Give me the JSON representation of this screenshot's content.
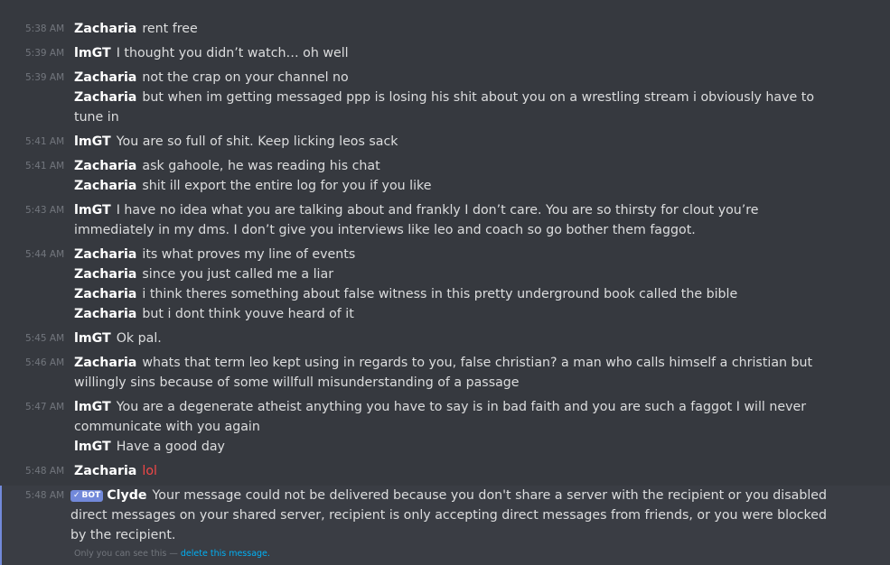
{
  "messages": [
    {
      "time": "5:38 AM",
      "author": "Zacharia",
      "text": "rent free",
      "first": true
    },
    {
      "time": "5:39 AM",
      "author": "lmGT",
      "text": "I thought you didn’t watch… oh well",
      "first": true
    },
    {
      "time": "5:39 AM",
      "author": "Zacharia",
      "text": "not the crap on your channel no",
      "first": true
    },
    {
      "time": "",
      "author": "Zacharia",
      "text": "but when im getting messaged ppp is losing his shit about you on a wrestling stream i obviously have to tune in",
      "first": false
    },
    {
      "time": "5:41 AM",
      "author": "lmGT",
      "text": "You are so full of shit. Keep licking leos sack",
      "first": true
    },
    {
      "time": "5:41 AM",
      "author": "Zacharia",
      "text": "ask gahoole, he was reading his chat",
      "first": true
    },
    {
      "time": "",
      "author": "Zacharia",
      "text": "shit ill export the entire log for you if you like",
      "first": false
    },
    {
      "time": "5:43 AM",
      "author": "lmGT",
      "text": "I have no idea what you are talking about and frankly I don’t care. You are so thirsty for clout you’re immediately in my dms. I don’t give you interviews like leo and coach so go bother them faggot.",
      "first": true
    },
    {
      "time": "5:44 AM",
      "author": "Zacharia",
      "text": "its what proves my line of events",
      "first": true
    },
    {
      "time": "",
      "author": "Zacharia",
      "text": "since you just called me a liar",
      "first": false
    },
    {
      "time": "",
      "author": "Zacharia",
      "text": "i think theres something about false witness in this pretty underground book called the bible",
      "first": false
    },
    {
      "time": "",
      "author": "Zacharia",
      "text": "but i dont think youve heard of it",
      "first": false
    },
    {
      "time": "5:45 AM",
      "author": "lmGT",
      "text": "Ok pal.",
      "first": true
    },
    {
      "time": "5:46 AM",
      "author": "Zacharia",
      "text": "whats that term leo kept using in regards to you, false christian? a man who calls himself a christian but willingly sins because of some willfull misunderstanding of a passage",
      "first": true
    },
    {
      "time": "5:47 AM",
      "author": "lmGT",
      "text": "You are a degenerate atheist anything you have to say is in bad faith and you are such a faggot I will never communicate with you again",
      "first": true
    },
    {
      "time": "",
      "author": "lmGT",
      "text": "Have a good day",
      "first": false
    },
    {
      "time": "5:48 AM",
      "author": "Zacharia",
      "text": "lol",
      "first": true,
      "highlight": true
    }
  ],
  "bot_message": {
    "time": "5:48 AM",
    "tag": "BOT",
    "tag_check": "✓",
    "author": "Clyde",
    "text": "Your message could not be delivered because you don't share a server with the recipient or you disabled direct messages on your shared server, recipient is only accepting direct messages from friends, or you were blocked by the recipient.",
    "ephemeral_note": "Only you can see this —",
    "delete_link": "delete this message."
  },
  "colors": {
    "background": "#36393f",
    "author": "#ffffff",
    "text": "#dcddde",
    "timestamp": "#72767d",
    "highlight_text": "#f04747",
    "bot_tag": "#7289da",
    "link": "#00b0f4"
  }
}
